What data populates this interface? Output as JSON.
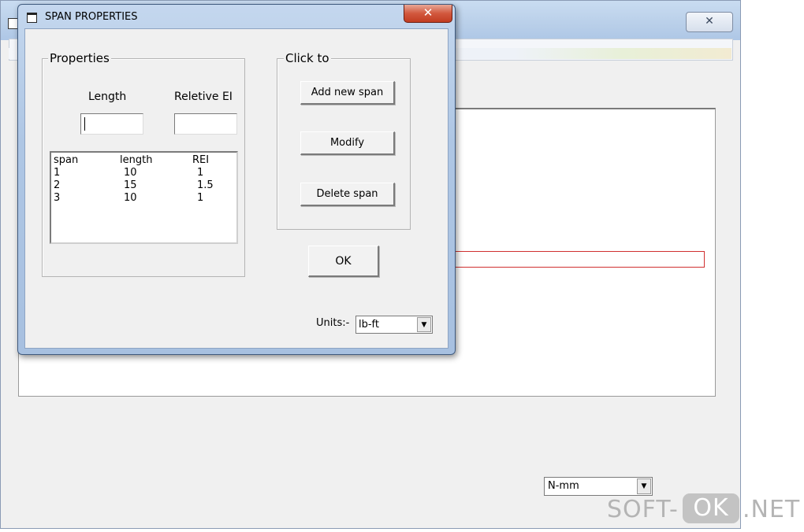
{
  "dialog": {
    "title": "SPAN PROPERTIES",
    "close_glyph": "✕",
    "properties_group": {
      "legend": "Properties",
      "length_label": "Length",
      "rel_ei_label": "Reletive EI",
      "length_value": "",
      "rel_ei_value": "",
      "list": {
        "headers": [
          "span",
          "length",
          "REI"
        ],
        "rows": [
          [
            "1",
            "10",
            "1"
          ],
          [
            "2",
            "15",
            "1.5"
          ],
          [
            "3",
            "10",
            "1"
          ]
        ]
      }
    },
    "click_group": {
      "legend": "Click to",
      "add_label": "Add new span",
      "modify_label": "Modify",
      "delete_label": "Delete span"
    },
    "ok_label": "OK",
    "units_label": "Units:-",
    "units_value": "lb-ft",
    "dropdown_glyph": "▼"
  },
  "main": {
    "close_glyph": "✕",
    "units_value": "N-mm",
    "dropdown_glyph": "▼"
  },
  "watermark": {
    "left": "SOFT-",
    "middle": "OK",
    "right": ".NET"
  },
  "colors": {
    "dialog_frame": "#aec6e4",
    "close_button": "#d2583e",
    "red_box": "#d03030"
  }
}
